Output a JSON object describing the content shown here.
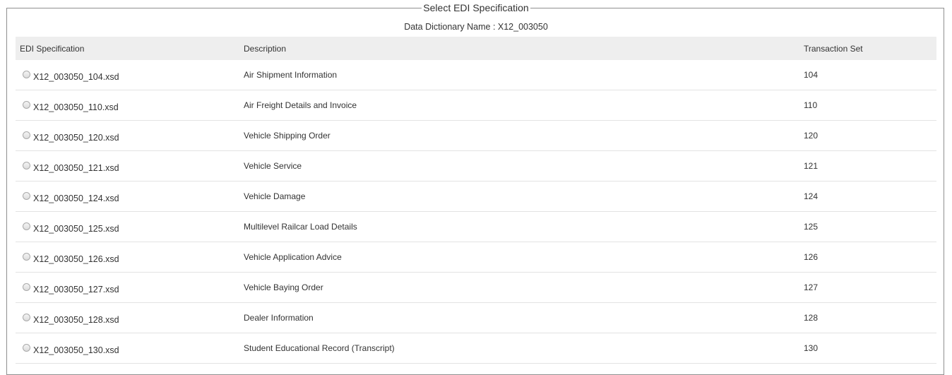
{
  "fieldset": {
    "legend": "Select EDI Specification",
    "dictionary_label": "Data Dictionary Name : X12_003050"
  },
  "table": {
    "headers": {
      "spec": "EDI Specification",
      "description": "Description",
      "transaction_set": "Transaction Set"
    },
    "rows": [
      {
        "file": "X12_003050_104.xsd",
        "description": "Air Shipment Information",
        "transaction_set": "104"
      },
      {
        "file": "X12_003050_110.xsd",
        "description": "Air Freight Details and Invoice",
        "transaction_set": "110"
      },
      {
        "file": "X12_003050_120.xsd",
        "description": "Vehicle Shipping Order",
        "transaction_set": "120"
      },
      {
        "file": "X12_003050_121.xsd",
        "description": "Vehicle Service",
        "transaction_set": "121"
      },
      {
        "file": "X12_003050_124.xsd",
        "description": "Vehicle Damage",
        "transaction_set": "124"
      },
      {
        "file": "X12_003050_125.xsd",
        "description": "Multilevel Railcar Load Details",
        "transaction_set": "125"
      },
      {
        "file": "X12_003050_126.xsd",
        "description": "Vehicle Application Advice",
        "transaction_set": "126"
      },
      {
        "file": "X12_003050_127.xsd",
        "description": "Vehicle Baying Order",
        "transaction_set": "127"
      },
      {
        "file": "X12_003050_128.xsd",
        "description": "Dealer Information",
        "transaction_set": "128"
      },
      {
        "file": "X12_003050_130.xsd",
        "description": "Student Educational Record (Transcript)",
        "transaction_set": "130"
      }
    ]
  }
}
